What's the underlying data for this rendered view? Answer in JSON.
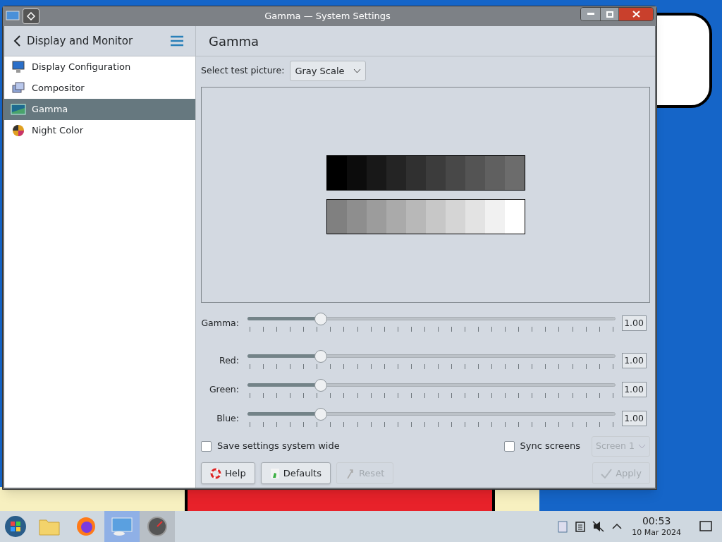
{
  "window": {
    "title": "Gamma — System Settings"
  },
  "sidebar": {
    "title": "Display and Monitor",
    "items": [
      {
        "label": "Display Configuration",
        "selected": false,
        "kind": "display"
      },
      {
        "label": "Compositor",
        "selected": false,
        "kind": "compositor"
      },
      {
        "label": "Gamma",
        "selected": true,
        "kind": "gamma"
      },
      {
        "label": "Night Color",
        "selected": false,
        "kind": "night"
      }
    ]
  },
  "page": {
    "title": "Gamma",
    "test_picture": {
      "label": "Select test picture:",
      "value": "Gray Scale"
    },
    "sliders": [
      {
        "label": "Gamma:",
        "level": 0.2,
        "reading": "1.00"
      },
      {
        "label": "Red:",
        "level": 0.2,
        "reading": "1.00"
      },
      {
        "label": "Green:",
        "level": 0.2,
        "reading": "1.00"
      },
      {
        "label": "Blue:",
        "level": 0.2,
        "reading": "1.00"
      }
    ],
    "save_system_wide": {
      "label": "Save settings system wide",
      "checked": false
    },
    "sync_screens": {
      "label": "Sync screens",
      "checked": false
    },
    "screen_select": {
      "value": "Screen 1",
      "disabled": true
    },
    "buttons": [
      {
        "label": "Help",
        "kind": "help",
        "disabled": false
      },
      {
        "label": "Defaults",
        "kind": "defaults",
        "disabled": false
      },
      {
        "label": "Reset",
        "kind": "reset",
        "disabled": true
      }
    ],
    "apply": {
      "label": "Apply",
      "disabled": true
    }
  },
  "taskbar": {
    "time": "00:53",
    "date": "10 Mar 2024"
  }
}
